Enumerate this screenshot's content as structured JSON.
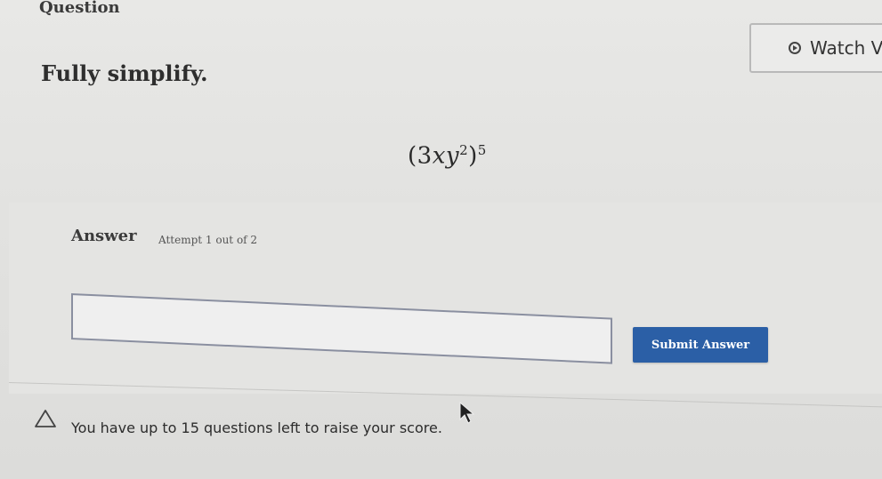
{
  "header": {
    "section_label": "Question",
    "watch_video_label": "Watch V"
  },
  "question": {
    "prompt": "Fully simplify.",
    "expression": {
      "base_coefficient": "3",
      "var_x": "x",
      "var_y": "y",
      "y_exponent": "2",
      "outer_exponent": "5"
    }
  },
  "answer": {
    "label": "Answer",
    "attempt_text": "Attempt 1 out of 2",
    "input_value": "",
    "submit_label": "Submit Answer"
  },
  "notice": {
    "text": "You have up to 15 questions left to raise your score."
  },
  "icons": {
    "watch": "play-circle-icon",
    "notice": "warning-triangle-icon",
    "pointer": "mouse-cursor-icon"
  },
  "colors": {
    "submit_bg": "#2b5fa6",
    "input_border": "#8a8fa0"
  }
}
